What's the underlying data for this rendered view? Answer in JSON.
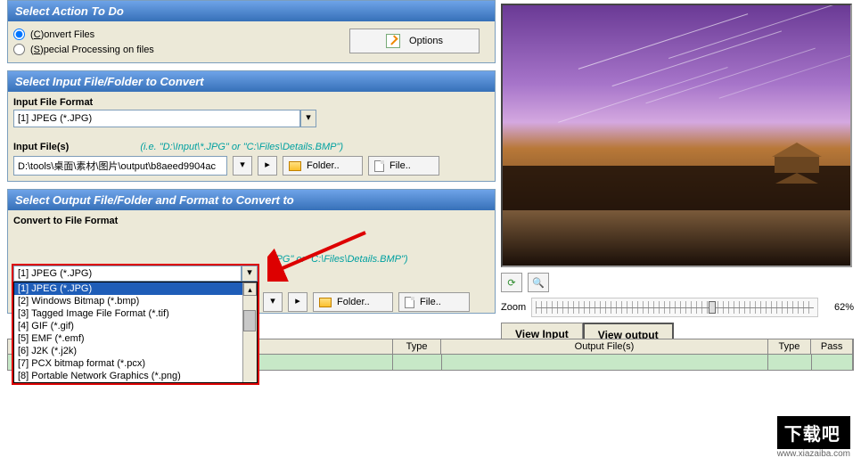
{
  "panel1": {
    "title": "Select Action To Do",
    "opt_convert": "onvert Files",
    "opt_convert_u": "C",
    "opt_special": "pecial Processing on files",
    "opt_special_u": "S",
    "options_btn": "Options"
  },
  "panel2": {
    "title": "Select Input File/Folder to Convert",
    "format_label": "Input File Format",
    "format_value": "[1] JPEG (*.JPG)",
    "files_label": "Input File(s)",
    "hint": "(i.e. \"D:\\Input\\*.JPG\" or \"C:\\Files\\Details.BMP\")",
    "path_value": "D:\\tools\\桌面\\素材\\图片\\output\\b8aeed9904ac",
    "folder_btn": "Folder..",
    "file_btn": "File.."
  },
  "panel3": {
    "title": "Select Output File/Folder and Format to Convert to",
    "format_label": "Convert to File Format",
    "selected": "[1] JPEG (*.JPG)",
    "options": [
      "[1] JPEG (*.JPG)",
      "[2] Windows Bitmap (*.bmp)",
      "[3] Tagged Image File Format (*.tif)",
      "[4] GIF (*.gif)",
      "[5] EMF (*.emf)",
      "[6] J2K (*.j2k)",
      "[7] PCX bitmap format (*.pcx)",
      "[8] Portable Network Graphics (*.png)"
    ],
    "hint_suffix": ".JPG\" or \"C:\\Files\\Details.BMP\")",
    "folder_btn": "Folder..",
    "file_btn": "File.."
  },
  "preview": {
    "zoom_label": "Zoom",
    "zoom_value": "62%",
    "view_input": "View Input",
    "view_output": "View output"
  },
  "table": {
    "h_type1": "Type",
    "h_out": "Output File(s)",
    "h_type2": "Type",
    "h_pass": "Pass"
  },
  "watermark": {
    "logo": "下载吧",
    "url": "www.xiazaiba.com"
  }
}
